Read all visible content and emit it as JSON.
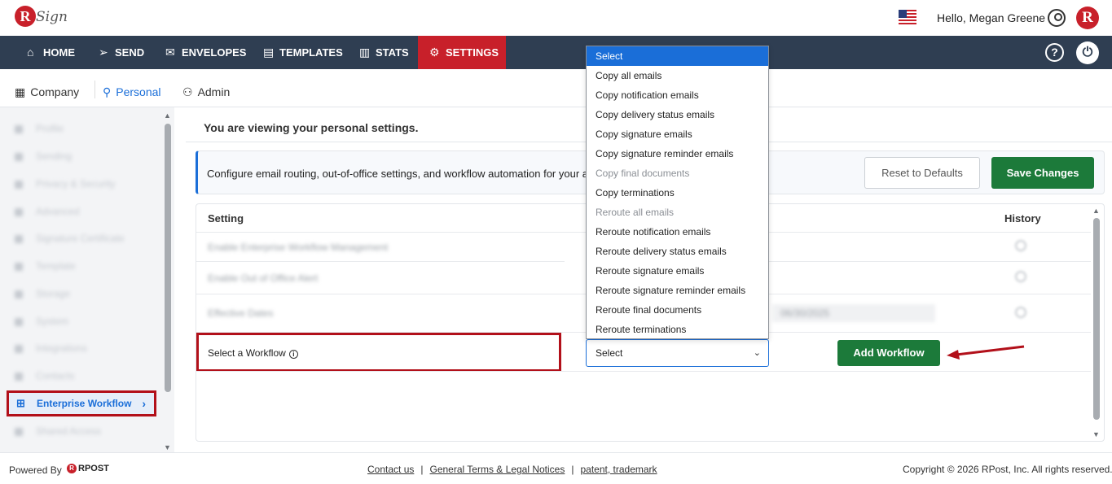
{
  "header": {
    "logo_text": "Sign",
    "greeting": "Hello, Megan Greene",
    "brand_initial": "R"
  },
  "nav": {
    "items": [
      {
        "label": "HOME",
        "icon": "home-icon"
      },
      {
        "label": "SEND",
        "icon": "send-icon"
      },
      {
        "label": "ENVELOPES",
        "icon": "envelope-icon"
      },
      {
        "label": "TEMPLATES",
        "icon": "document-icon"
      },
      {
        "label": "STATS",
        "icon": "bar-chart-icon"
      },
      {
        "label": "SETTINGS",
        "icon": "gear-icon",
        "active": true
      }
    ],
    "help_label": "?",
    "active_color": "#c8202a",
    "bg_color": "#2f3e52"
  },
  "subtabs": {
    "items": [
      {
        "label": "Company",
        "icon": "building-icon"
      },
      {
        "label": "Personal",
        "icon": "person-icon",
        "active": true
      },
      {
        "label": "Admin",
        "icon": "user-gear-icon"
      }
    ]
  },
  "sidebar": {
    "blurred_items": [
      "Profile",
      "Sending",
      "Privacy & Security",
      "Advanced",
      "Signature Certificate",
      "Template",
      "Storage",
      "System",
      "Integrations",
      "Contacts"
    ],
    "active_item": "Enterprise Workflow",
    "after_item": "Shared Access"
  },
  "main": {
    "viewing_text": "You are viewing your personal settings.",
    "info_text": "Configure email routing, out-of-office settings, and workflow automation for your account.",
    "reset_label": "Reset to Defaults",
    "save_label": "Save Changes",
    "table": {
      "col_setting": "Setting",
      "col_history": "History",
      "blurred_rows": [
        "Enable Enterprise Workflow Management",
        "Enable Out of Office Alert",
        "Effective Dates"
      ],
      "blurred_date": "06/30/2025",
      "workflow_label": "Select a Workflow",
      "select_value": "Select",
      "add_label": "Add Workflow"
    }
  },
  "dropdown": {
    "options": [
      {
        "label": "Select",
        "state": "selected"
      },
      {
        "label": "Copy all emails",
        "state": "normal"
      },
      {
        "label": "Copy notification emails",
        "state": "normal"
      },
      {
        "label": "Copy delivery status emails",
        "state": "normal"
      },
      {
        "label": "Copy signature emails",
        "state": "normal"
      },
      {
        "label": "Copy signature reminder emails",
        "state": "normal"
      },
      {
        "label": "Copy final documents",
        "state": "disabled"
      },
      {
        "label": "Copy terminations",
        "state": "normal"
      },
      {
        "label": "Reroute all emails",
        "state": "disabled"
      },
      {
        "label": "Reroute notification emails",
        "state": "normal"
      },
      {
        "label": "Reroute delivery status emails",
        "state": "normal"
      },
      {
        "label": "Reroute signature emails",
        "state": "normal"
      },
      {
        "label": "Reroute signature reminder emails",
        "state": "normal"
      },
      {
        "label": "Reroute final documents",
        "state": "normal"
      },
      {
        "label": "Reroute terminations",
        "state": "normal"
      }
    ]
  },
  "footer": {
    "powered_by": "Powered By",
    "rpost": "RPOST",
    "links": [
      "Contact us",
      "General Terms & Legal Notices",
      "patent, trademark"
    ],
    "copyright": "Copyright © 2026 RPost, Inc. All rights reserved."
  },
  "colors": {
    "accent_blue": "#1a6ed8",
    "save_green": "#1c7a3a",
    "highlight_red": "#b2101a"
  }
}
